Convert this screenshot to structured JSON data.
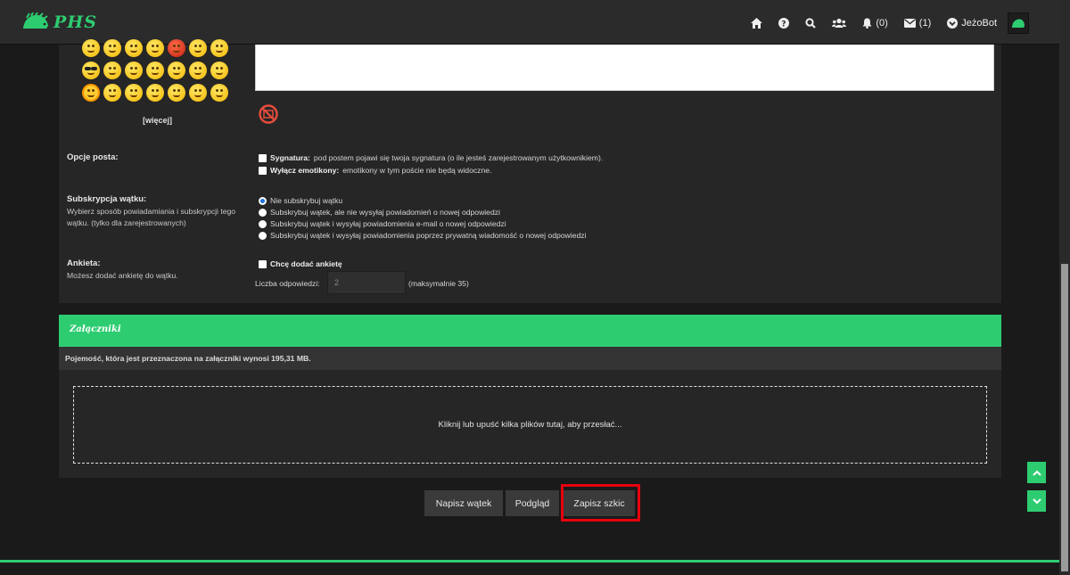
{
  "header": {
    "logo_text": "PHS",
    "notifications": "(0)",
    "messages": "(1)",
    "username": "JeżoBot"
  },
  "editor": {
    "more_label": "[więcej]"
  },
  "post_options": {
    "label": "Opcje posta:",
    "signature_bold": "Sygnatura:",
    "signature_text": "pod postem pojawi się twoja sygnatura (o ile jesteś zarejestrowanym użytkownikiem).",
    "emoticons_bold": "Wyłącz emotikony:",
    "emoticons_text": "emotikony w tym poście nie będą widoczne."
  },
  "subscription": {
    "label": "Subskrypcja wątku:",
    "description": "Wybierz sposób powiadamiania i subskrypcji tego wątku. (tylko dla zarejestrowanych)",
    "options": [
      "Nie subskrybuj wątku",
      "Subskrybuj wątek, ale nie wysyłaj powiadomień o nowej odpowiedzi",
      "Subskrybuj wątek i wysyłaj powiadomienia e-mail o nowej odpowiedzi",
      "Subskrybuj wątek i wysyłaj powiadomienia poprzez prywatną wiadomość o nowej odpowiedzi"
    ],
    "selected": 0
  },
  "poll": {
    "label": "Ankieta:",
    "description": "Możesz dodać ankietę do wątku.",
    "add_poll_label": "Chcę dodać ankietę",
    "count_label": "Liczba odpowiedzi:",
    "count_value": "2",
    "count_max": "(maksymalnie 35)"
  },
  "attachments": {
    "title": "Załączniki",
    "capacity_text": "Pojemość, która jest przeznaczona na załączniki wynosi 195,31 MB.",
    "dropzone_text": "Kliknij lub upuść kilka plików tutaj, aby przesłać..."
  },
  "actions": {
    "post_thread": "Napisz wątek",
    "preview": "Podgląd",
    "save_draft": "Zapisz szkic"
  },
  "colors": {
    "accent": "#2ecc71",
    "highlight": "#e8000e",
    "background": "#1a1a1a"
  }
}
